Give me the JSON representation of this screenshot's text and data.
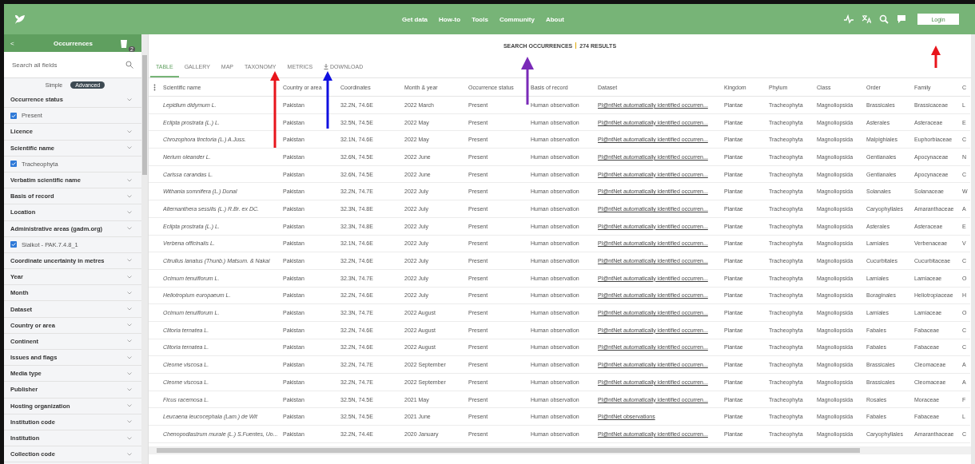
{
  "top_nav": {
    "links": [
      "Get data",
      "How-to",
      "Tools",
      "Community",
      "About"
    ],
    "login": "Login"
  },
  "sidebar": {
    "back": "<",
    "title": "Occurrences",
    "badge": "2",
    "search": {
      "placeholder": "Search all fields"
    },
    "modes": [
      {
        "label": "Simple",
        "selected": false
      },
      {
        "label": "Advanced",
        "selected": true
      }
    ],
    "filters": [
      {
        "kind": "group",
        "label": "Occurrence status"
      },
      {
        "kind": "option",
        "label": "Present",
        "checked": true
      },
      {
        "kind": "group",
        "label": "Licence"
      },
      {
        "kind": "group",
        "label": "Scientific name"
      },
      {
        "kind": "option",
        "label": "Tracheophyta",
        "checked": true
      },
      {
        "kind": "group",
        "label": "Verbatim scientific name"
      },
      {
        "kind": "group",
        "label": "Basis of record"
      },
      {
        "kind": "group",
        "label": "Location"
      },
      {
        "kind": "group",
        "label": "Administrative areas (gadm.org)"
      },
      {
        "kind": "option",
        "label": "Sialkot - PAK.7.4.8_1",
        "checked": true
      },
      {
        "kind": "group",
        "label": "Coordinate uncertainty in metres"
      },
      {
        "kind": "group",
        "label": "Year"
      },
      {
        "kind": "group",
        "label": "Month"
      },
      {
        "kind": "group",
        "label": "Dataset"
      },
      {
        "kind": "group",
        "label": "Country or area"
      },
      {
        "kind": "group",
        "label": "Continent"
      },
      {
        "kind": "group",
        "label": "Issues and flags"
      },
      {
        "kind": "group",
        "label": "Media type"
      },
      {
        "kind": "group",
        "label": "Publisher"
      },
      {
        "kind": "group",
        "label": "Hosting organization"
      },
      {
        "kind": "group",
        "label": "Institution code"
      },
      {
        "kind": "group",
        "label": "Institution"
      },
      {
        "kind": "group",
        "label": "Collection code"
      }
    ]
  },
  "results": {
    "title": "SEARCH OCCURRENCES",
    "count": "274 RESULTS"
  },
  "tabs": [
    {
      "label": "TABLE",
      "selected": true
    },
    {
      "label": "GALLERY",
      "selected": false
    },
    {
      "label": "MAP",
      "selected": false
    },
    {
      "label": "TAXONOMY",
      "selected": false
    },
    {
      "label": "METRICS",
      "selected": false
    },
    {
      "label": "DOWNLOAD",
      "selected": false,
      "kind": "download"
    }
  ],
  "table": {
    "columns": [
      {
        "label": "Scientific name",
        "kind": "italic"
      },
      {
        "label": "Country or area",
        "kind": "text"
      },
      {
        "label": "Coordinates",
        "kind": "text"
      },
      {
        "label": "Month & year",
        "kind": "text"
      },
      {
        "label": "Occurrence status",
        "kind": "text"
      },
      {
        "label": "Basis of record",
        "kind": "text"
      },
      {
        "label": "Dataset",
        "kind": "link"
      },
      {
        "label": "Kingdom",
        "kind": "text"
      },
      {
        "label": "Phylum",
        "kind": "text"
      },
      {
        "label": "Class",
        "kind": "text"
      },
      {
        "label": "Order",
        "kind": "text"
      },
      {
        "label": "Family",
        "kind": "text"
      },
      {
        "label": "C",
        "kind": "text"
      }
    ],
    "rows": [
      [
        "Lepidium didymum L.",
        "Pakistan",
        "32.2N, 74.6E",
        "2022 March",
        "Present",
        "Human observation",
        "Pl@ntNet automatically identified occurren...",
        "Plantae",
        "Tracheophyta",
        "Magnoliopsida",
        "Brassicales",
        "Brassicaceae",
        "L"
      ],
      [
        "Eclipta prostrata (L.) L.",
        "Pakistan",
        "32.5N, 74.5E",
        "2022 May",
        "Present",
        "Human observation",
        "Pl@ntNet automatically identified occurren...",
        "Plantae",
        "Tracheophyta",
        "Magnoliopsida",
        "Asterales",
        "Asteraceae",
        "E"
      ],
      [
        "Chrozophora tinctoria (L.) A.Juss.",
        "Pakistan",
        "32.1N, 74.6E",
        "2022 May",
        "Present",
        "Human observation",
        "Pl@ntNet automatically identified occurren...",
        "Plantae",
        "Tracheophyta",
        "Magnoliopsida",
        "Malpighiales",
        "Euphorbiaceae",
        "C"
      ],
      [
        "Nerium oleander L.",
        "Pakistan",
        "32.6N, 74.5E",
        "2022 June",
        "Present",
        "Human observation",
        "Pl@ntNet automatically identified occurren...",
        "Plantae",
        "Tracheophyta",
        "Magnoliopsida",
        "Gentianales",
        "Apocynaceae",
        "N"
      ],
      [
        "Carissa carandas L.",
        "Pakistan",
        "32.6N, 74.5E",
        "2022 June",
        "Present",
        "Human observation",
        "Pl@ntNet automatically identified occurren...",
        "Plantae",
        "Tracheophyta",
        "Magnoliopsida",
        "Gentianales",
        "Apocynaceae",
        "C"
      ],
      [
        "Withania somnifera (L.) Dunal",
        "Pakistan",
        "32.2N, 74.7E",
        "2022 July",
        "Present",
        "Human observation",
        "Pl@ntNet automatically identified occurren...",
        "Plantae",
        "Tracheophyta",
        "Magnoliopsida",
        "Solanales",
        "Solanaceae",
        "W"
      ],
      [
        "Alternanthera sessilis (L.) R.Br. ex DC.",
        "Pakistan",
        "32.3N, 74.8E",
        "2022 July",
        "Present",
        "Human observation",
        "Pl@ntNet automatically identified occurren...",
        "Plantae",
        "Tracheophyta",
        "Magnoliopsida",
        "Caryophyllales",
        "Amaranthaceae",
        "A"
      ],
      [
        "Eclipta prostrata (L.) L.",
        "Pakistan",
        "32.3N, 74.8E",
        "2022 July",
        "Present",
        "Human observation",
        "Pl@ntNet automatically identified occurren...",
        "Plantae",
        "Tracheophyta",
        "Magnoliopsida",
        "Asterales",
        "Asteraceae",
        "E"
      ],
      [
        "Verbena officinalis L.",
        "Pakistan",
        "32.1N, 74.6E",
        "2022 July",
        "Present",
        "Human observation",
        "Pl@ntNet automatically identified occurren...",
        "Plantae",
        "Tracheophyta",
        "Magnoliopsida",
        "Lamiales",
        "Verbenaceae",
        "V"
      ],
      [
        "Citrullus lanatus (Thunb.) Matsum. & Nakai",
        "Pakistan",
        "32.2N, 74.6E",
        "2022 July",
        "Present",
        "Human observation",
        "Pl@ntNet automatically identified occurren...",
        "Plantae",
        "Tracheophyta",
        "Magnoliopsida",
        "Cucurbitales",
        "Cucurbitaceae",
        "C"
      ],
      [
        "Ocimum tenuiflorum L.",
        "Pakistan",
        "32.3N, 74.7E",
        "2022 July",
        "Present",
        "Human observation",
        "Pl@ntNet automatically identified occurren...",
        "Plantae",
        "Tracheophyta",
        "Magnoliopsida",
        "Lamiales",
        "Lamiaceae",
        "O"
      ],
      [
        "Heliotropium europaeum L.",
        "Pakistan",
        "32.2N, 74.6E",
        "2022 July",
        "Present",
        "Human observation",
        "Pl@ntNet automatically identified occurren...",
        "Plantae",
        "Tracheophyta",
        "Magnoliopsida",
        "Boraginales",
        "Heliotropiaceae",
        "H"
      ],
      [
        "Ocimum tenuiflorum L.",
        "Pakistan",
        "32.3N, 74.7E",
        "2022 August",
        "Present",
        "Human observation",
        "Pl@ntNet automatically identified occurren...",
        "Plantae",
        "Tracheophyta",
        "Magnoliopsida",
        "Lamiales",
        "Lamiaceae",
        "O"
      ],
      [
        "Clitoria ternatea L.",
        "Pakistan",
        "32.2N, 74.6E",
        "2022 August",
        "Present",
        "Human observation",
        "Pl@ntNet automatically identified occurren...",
        "Plantae",
        "Tracheophyta",
        "Magnoliopsida",
        "Fabales",
        "Fabaceae",
        "C"
      ],
      [
        "Clitoria ternatea L.",
        "Pakistan",
        "32.2N, 74.6E",
        "2022 August",
        "Present",
        "Human observation",
        "Pl@ntNet automatically identified occurren...",
        "Plantae",
        "Tracheophyta",
        "Magnoliopsida",
        "Fabales",
        "Fabaceae",
        "C"
      ],
      [
        "Cleome viscosa L.",
        "Pakistan",
        "32.2N, 74.7E",
        "2022 September",
        "Present",
        "Human observation",
        "Pl@ntNet automatically identified occurren...",
        "Plantae",
        "Tracheophyta",
        "Magnoliopsida",
        "Brassicales",
        "Cleomaceae",
        "A"
      ],
      [
        "Cleome viscosa L.",
        "Pakistan",
        "32.2N, 74.7E",
        "2022 September",
        "Present",
        "Human observation",
        "Pl@ntNet automatically identified occurren...",
        "Plantae",
        "Tracheophyta",
        "Magnoliopsida",
        "Brassicales",
        "Cleomaceae",
        "A"
      ],
      [
        "Ficus racemosa L.",
        "Pakistan",
        "32.5N, 74.5E",
        "2021 May",
        "Present",
        "Human observation",
        "Pl@ntNet automatically identified occurren...",
        "Plantae",
        "Tracheophyta",
        "Magnoliopsida",
        "Rosales",
        "Moraceae",
        "F"
      ],
      [
        "Leucaena leucocephala (Lam.) de Wit",
        "Pakistan",
        "32.5N, 74.5E",
        "2021 June",
        "Present",
        "Human observation",
        "Pl@ntNet observations",
        "Plantae",
        "Tracheophyta",
        "Magnoliopsida",
        "Fabales",
        "Fabaceae",
        "L"
      ],
      [
        "Chenopodiastrum murale (L.) S.Fuentes, Uo...",
        "Pakistan",
        "32.2N, 74.4E",
        "2020 January",
        "Present",
        "Human observation",
        "Pl@ntNet automatically identified occurren...",
        "Plantae",
        "Tracheophyta",
        "Magnoliopsida",
        "Caryophyllales",
        "Amaranthaceae",
        "C"
      ]
    ]
  },
  "annotations": [
    {
      "color": "#e8141b"
    },
    {
      "color": "#1010e0"
    },
    {
      "color": "#7a2ab8"
    },
    {
      "color": "#e8141b"
    }
  ]
}
